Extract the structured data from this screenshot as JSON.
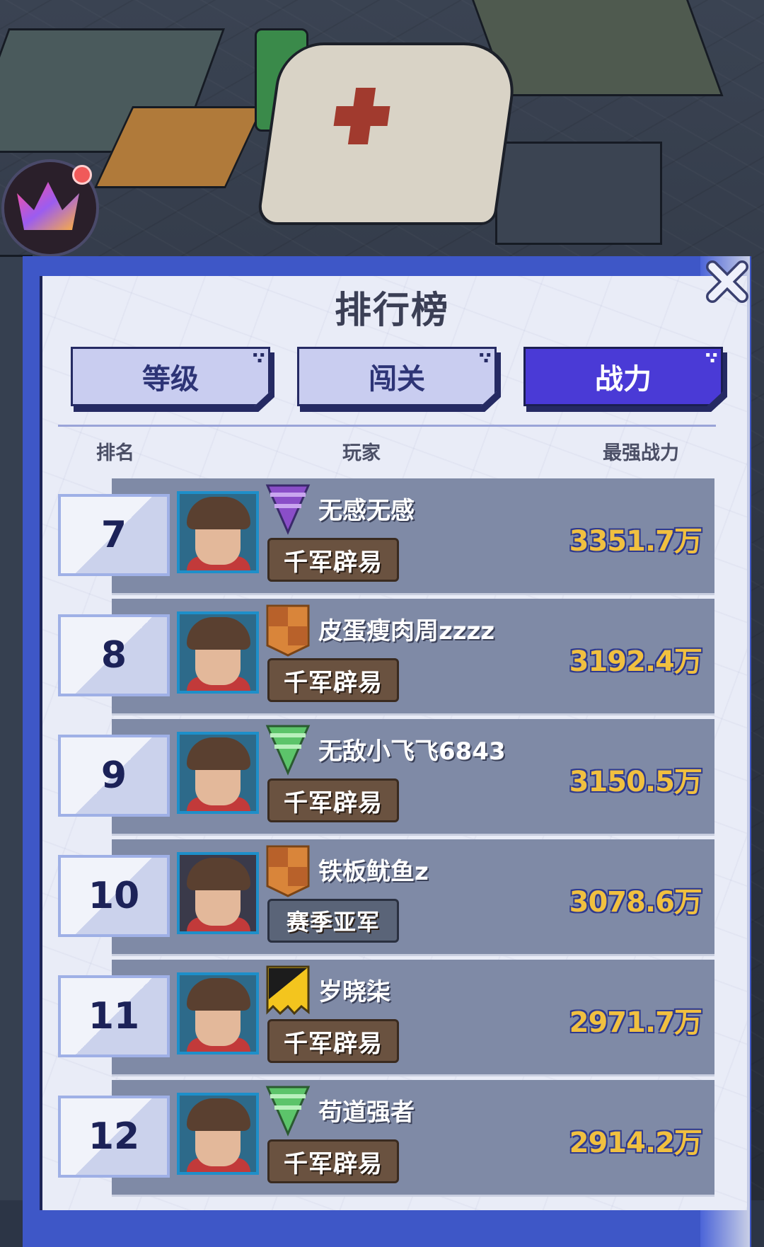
{
  "leaderboard": {
    "title": "排行榜",
    "tabs": [
      {
        "label": "等级",
        "active": false
      },
      {
        "label": "闯关",
        "active": false
      },
      {
        "label": "战力",
        "active": true
      }
    ],
    "headers": {
      "rank": "排名",
      "player": "玩家",
      "power": "最强战力"
    }
  },
  "rows": [
    {
      "rank": "7",
      "name": "无感无感",
      "title": "千军辟易",
      "power": "3351.7万",
      "emblem": "purple-triangle-emblem",
      "avatar_color": "#2d6a8a"
    },
    {
      "rank": "8",
      "name": "皮蛋瘦肉周zzzz",
      "title": "千军辟易",
      "power": "3192.4万",
      "emblem": "orange-checker-shield-emblem",
      "avatar_color": "#2d6a8a"
    },
    {
      "rank": "9",
      "name": "无敌小飞飞6843",
      "title": "千军辟易",
      "power": "3150.5万",
      "emblem": "green-triangle-emblem",
      "avatar_color": "#2d6a8a"
    },
    {
      "rank": "10",
      "name": "铁板鱿鱼z",
      "title": "赛季亚军",
      "power": "3078.6万",
      "emblem": "orange-checker-shield-emblem",
      "avatar_color": "#3a3a4a"
    },
    {
      "rank": "11",
      "name": "岁晓柒",
      "title": "千军辟易",
      "power": "2971.7万",
      "emblem": "black-yellow-shield-emblem",
      "avatar_color": "#2d6a8a"
    },
    {
      "rank": "12",
      "name": "苟道强者",
      "title": "千军辟易",
      "power": "2914.2万",
      "emblem": "green-triangle-emblem",
      "avatar_color": "#2d6a8a"
    }
  ],
  "colors": {
    "accent": "#4a3ad6",
    "power_text": "#f0c040",
    "row_bg": "#7f8aa6",
    "panel_bg": "#e9ecf7"
  }
}
